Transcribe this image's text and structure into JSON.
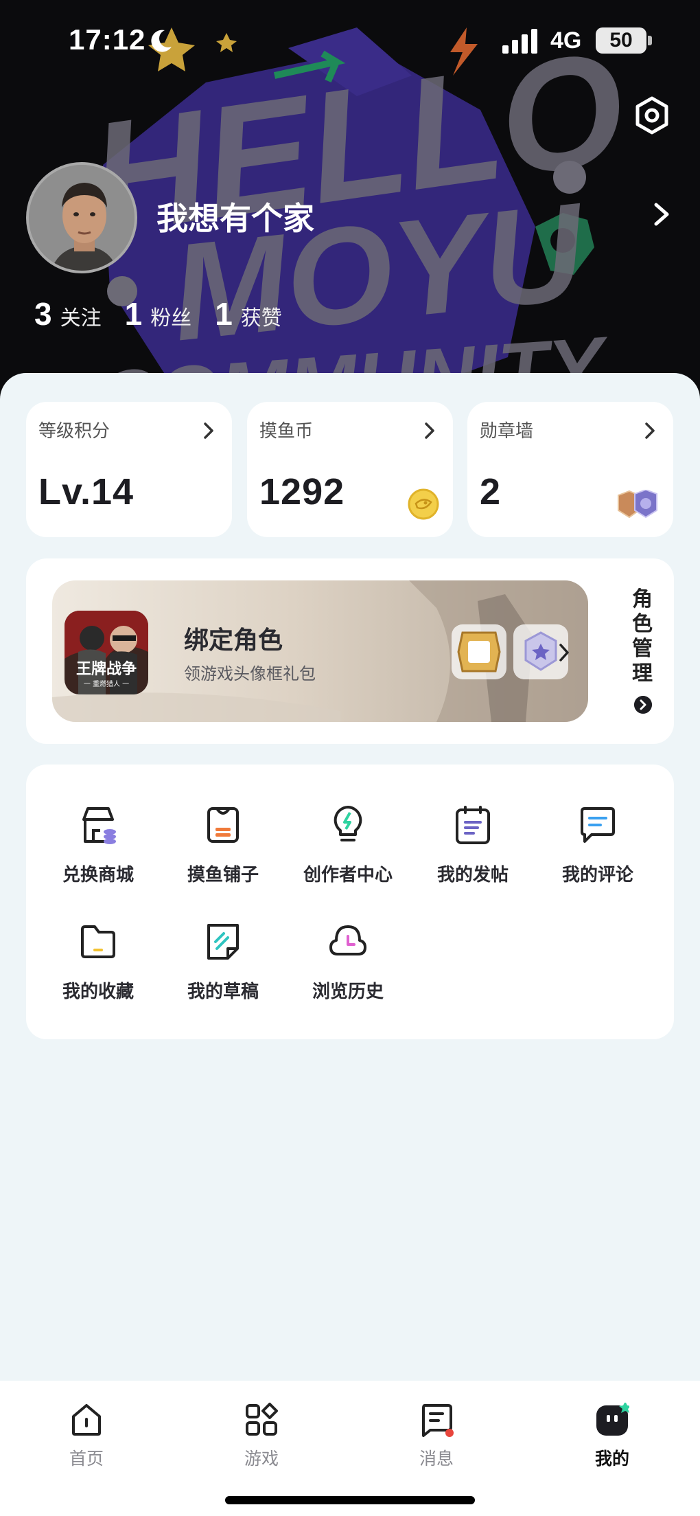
{
  "status_bar": {
    "time": "17:12",
    "network": "4G",
    "battery": "50"
  },
  "header": {
    "background_text": [
      "HELLO",
      "MOYU",
      "COMMUNITY"
    ]
  },
  "profile": {
    "username": "我想有个家",
    "stats": [
      {
        "count": "3",
        "label": "关注"
      },
      {
        "count": "1",
        "label": "粉丝"
      },
      {
        "count": "1",
        "label": "获赞"
      }
    ]
  },
  "stat_cards": [
    {
      "title": "等级积分",
      "value": "Lv.14",
      "icon": "level"
    },
    {
      "title": "摸鱼币",
      "value": "1292",
      "icon": "coin-icon"
    },
    {
      "title": "勋章墙",
      "value": "2",
      "icon": "medal-icon"
    }
  ],
  "bind": {
    "game_name": "王牌战争",
    "game_subtitle": "一 重燃猎人 一",
    "title": "绑定角色",
    "subtitle": "领游戏头像框礼包",
    "role_management": "角色管理"
  },
  "menu": [
    {
      "label": "兑换商城",
      "icon": "store-icon"
    },
    {
      "label": "摸鱼铺子",
      "icon": "shop-bag-icon"
    },
    {
      "label": "创作者中心",
      "icon": "lightbulb-icon"
    },
    {
      "label": "我的发帖",
      "icon": "clipboard-icon"
    },
    {
      "label": "我的评论",
      "icon": "comment-icon"
    },
    {
      "label": "我的收藏",
      "icon": "folder-icon"
    },
    {
      "label": "我的草稿",
      "icon": "draft-icon"
    },
    {
      "label": "浏览历史",
      "icon": "history-icon"
    }
  ],
  "tabs": [
    {
      "label": "首页",
      "icon": "home-icon",
      "active": false
    },
    {
      "label": "游戏",
      "icon": "games-icon",
      "active": false
    },
    {
      "label": "消息",
      "icon": "message-icon",
      "active": false,
      "badge": true
    },
    {
      "label": "我的",
      "icon": "profile-icon",
      "active": true
    }
  ],
  "colors": {
    "accent": "#1d1d22",
    "page_bg": "#eef5f8",
    "badge": "#e8453c",
    "purple_art": "#3a2a86",
    "green_art": "#1f6d4a"
  }
}
